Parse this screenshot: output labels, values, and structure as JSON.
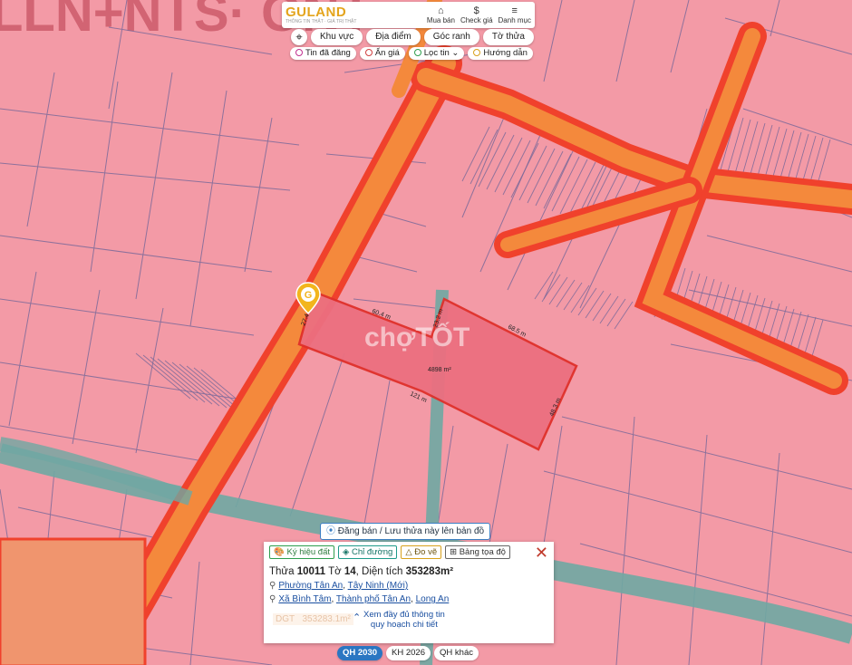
{
  "brand": {
    "name": "GULAND",
    "tagline": "THÔNG TIN THẬT · GIÁ TRỊ THẬT"
  },
  "top_nav": [
    {
      "label": "Mua bán",
      "icon": "house-icon"
    },
    {
      "label": "Check giá",
      "icon": "dollar-icon"
    },
    {
      "label": "Danh mục",
      "icon": "menu-icon"
    }
  ],
  "tools": [
    "Khu vực",
    "Địa điểm",
    "Góc ranh",
    "Tờ thửa"
  ],
  "filters": [
    {
      "label": "Tin đã đăng",
      "color": "#c0308f"
    },
    {
      "label": "Ẩn giá",
      "color": "#d04040"
    },
    {
      "label": "Lọc tin ⌄",
      "color": "#2e9e4e"
    },
    {
      "label": "Hướng dẫn",
      "color": "#d8a11c"
    }
  ],
  "map": {
    "watermark_bg": "LLN+NTS· ONT",
    "chotot_watermark": "chợTỐT",
    "dimensions": [
      "60.4 m",
      "23.2 m",
      "68.5 m",
      "48.3 m",
      "121 m",
      "27.4 m"
    ],
    "area_label": "4898 m²",
    "colors": {
      "zone": "#f39aa6",
      "road": "#f4893c",
      "road_edge": "#f0412c",
      "canal": "#6fa8a3",
      "parcel": "#ec6f80",
      "parcel_border": "#e0302a"
    }
  },
  "post_button": "Đăng bán / Lưu thửa này lên bản đồ",
  "panel": {
    "actions": [
      "Ký hiệu đất",
      "Chỉ đường",
      "Đo vẽ",
      "Bảng tọa độ"
    ],
    "title_prefix": "Thửa ",
    "parcel_no": "10011",
    "sheet_prefix": " Tờ ",
    "sheet_no": "14",
    "area_prefix": ", Diện tích ",
    "area": "353283m²",
    "address_new": [
      "Phường Tân An",
      "Tây Ninh (Mới)"
    ],
    "address_old": [
      "Xã Bình Tâm",
      "Thành phố Tân An",
      "Long An"
    ],
    "land_code": "DGT",
    "land_area": "353283.1m²",
    "more_line1": "Xem đầy đủ thông tin",
    "more_line2": "quy hoạch chi tiết"
  },
  "plan_tabs": [
    "QH 2030",
    "KH 2026",
    "QH khác"
  ],
  "active_plan_tab": "QH 2030"
}
